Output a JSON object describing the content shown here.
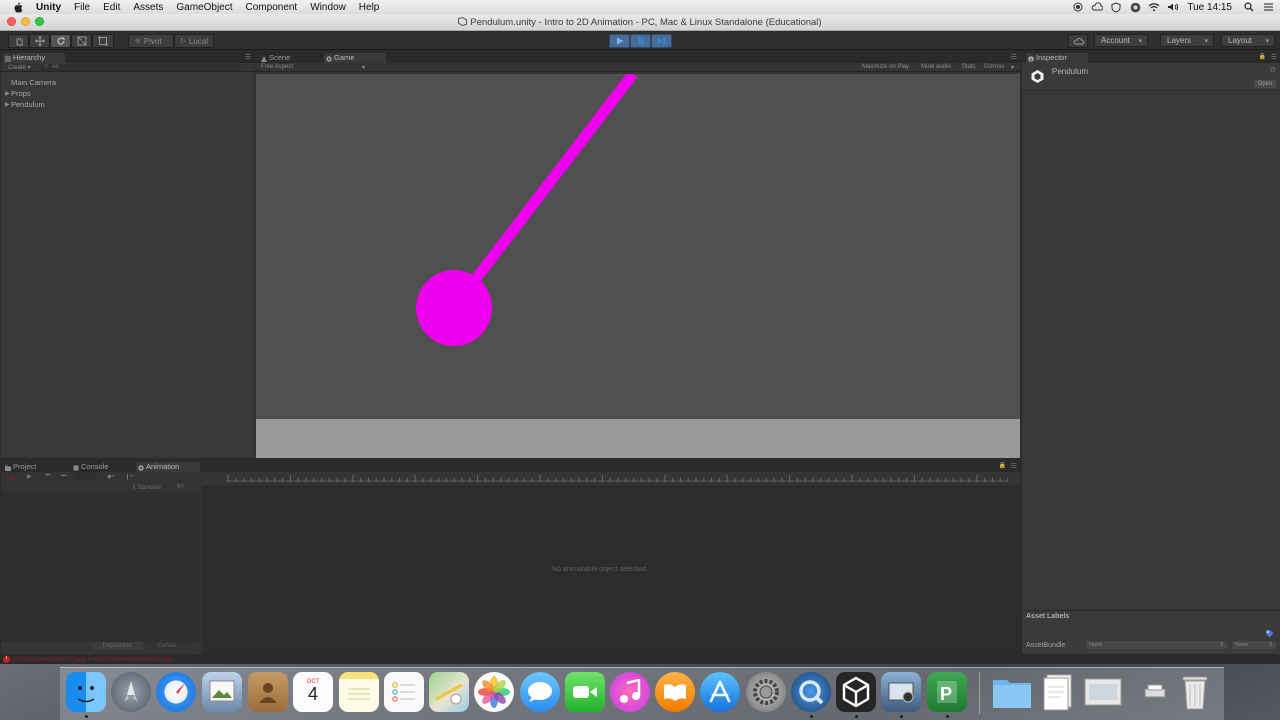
{
  "menubar": {
    "app_name": "Unity",
    "items": [
      "File",
      "Edit",
      "Assets",
      "GameObject",
      "Component",
      "Window",
      "Help"
    ],
    "clock": "Tue 14:15"
  },
  "window": {
    "title": "Pendulum.unity - Intro to 2D Animation - PC, Mac & Linux Standalone (Educational)"
  },
  "toolbar": {
    "pivot_label": "Pivot",
    "local_label": "Local",
    "account_label": "Account",
    "layers_label": "Layers",
    "layout_label": "Layout"
  },
  "hierarchy": {
    "tab_label": "Hierarchy",
    "create_label": "Create",
    "search_placeholder": "All",
    "items": [
      "Main Camera",
      "Props",
      "Pendulum"
    ]
  },
  "views": {
    "scene_tab": "Scene",
    "game_tab": "Game",
    "aspect_label": "Free Aspect",
    "maximize_label": "Maximize on Play",
    "mute_label": "Mute audio",
    "stats_label": "Stats",
    "gizmos_label": "Gizmos"
  },
  "game": {
    "pendulum_color": "#ee00ee",
    "background_color": "#505050",
    "ground_color": "#9a9a9a"
  },
  "inspector": {
    "tab_label": "Inspector",
    "object_name": "Pendulum",
    "open_label": "Open",
    "asset_labels_title": "Asset Labels",
    "assetbundle_label": "AssetBundle",
    "assetbundle_value": "None",
    "variant_value": "None"
  },
  "bottom": {
    "project_tab": "Project",
    "console_tab": "Console",
    "animation_tab": "Animation",
    "samples_label": "Samples",
    "samples_value": "60",
    "empty_message": "No animatable object selected.",
    "dopesheet_label": "Dopesheet",
    "curves_label": "Curves"
  },
  "status": {
    "error_text": "(re.DataAnnotationsType) = IsStandaloneAllowedPlugin"
  },
  "calendar": {
    "month": "OCT",
    "day": "4"
  }
}
